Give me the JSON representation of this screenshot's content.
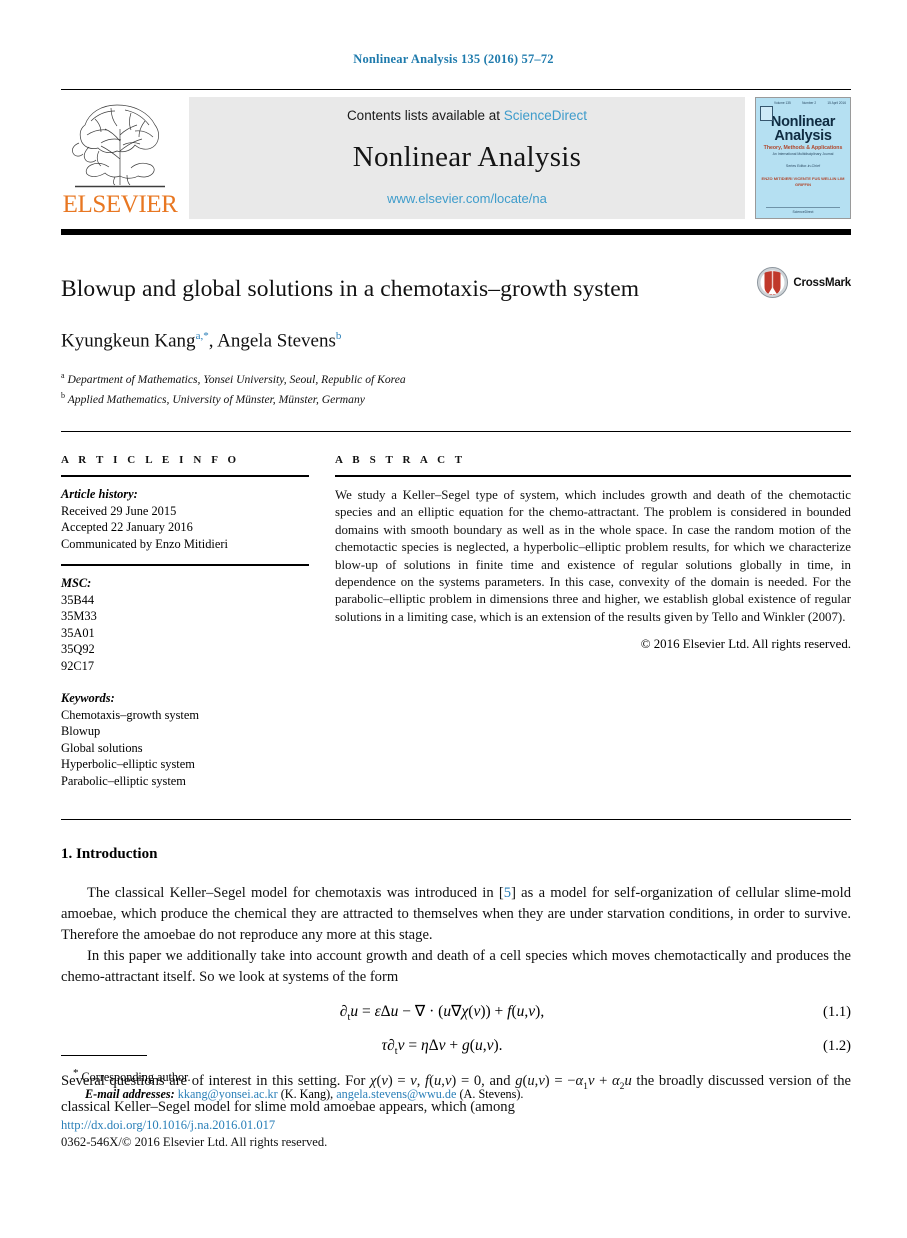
{
  "running_head": "Nonlinear Analysis 135 (2016) 57–72",
  "banner": {
    "publisher": "ELSEVIER",
    "contents_prefix": "Contents lists available at ",
    "contents_link": "ScienceDirect",
    "journal_name": "Nonlinear Analysis",
    "journal_url": "www.elsevier.com/locate/na",
    "cover": {
      "vol": "Volume 135",
      "num": "Number 2",
      "date": "15 April 2016",
      "title_line1": "Nonlinear",
      "title_line2": "Analysis",
      "subtitle": "Theory, Methods & Applications",
      "subtitle2": "An International Multidisciplinary Journal",
      "editors_label": "Series Editor-in-Chief",
      "editors": "ENZO MITIDIERI\nVICENTE FUS\nWEI-LIN LIM GRIFFIN",
      "footer": "ScienceDirect"
    }
  },
  "article": {
    "title": "Blowup and global solutions in a chemotaxis–growth system",
    "crossmark_label": "CrossMark",
    "authors": [
      {
        "name": "Kyungkeun Kang",
        "marks": "a,*"
      },
      {
        "name": "Angela Stevens",
        "marks": "b"
      }
    ],
    "authors_line_sep": ", ",
    "affiliations": [
      {
        "mark": "a",
        "text": "Department of Mathematics, Yonsei University, Seoul, Republic of Korea"
      },
      {
        "mark": "b",
        "text": "Applied Mathematics, University of Münster, Münster, Germany"
      }
    ]
  },
  "article_info": {
    "heading": "A R T I C L E   I N F O",
    "history_label": "Article history:",
    "history": [
      "Received 29 June 2015",
      "Accepted 22 January 2016",
      "Communicated by Enzo Mitidieri"
    ],
    "msc_label": "MSC:",
    "msc": [
      "35B44",
      "35M33",
      "35A01",
      "35Q92",
      "92C17"
    ],
    "keywords_label": "Keywords:",
    "keywords": [
      "Chemotaxis–growth system",
      "Blowup",
      "Global solutions",
      "Hyperbolic–elliptic system",
      "Parabolic–elliptic system"
    ]
  },
  "abstract": {
    "heading": "A B S T R A C T",
    "text": "We study a Keller–Segel type of system, which includes growth and death of the chemotactic species and an elliptic equation for the chemo-attractant. The problem is considered in bounded domains with smooth boundary as well as in the whole space. In case the random motion of the chemotactic species is neglected, a hyperbolic–elliptic problem results, for which we characterize blow-up of solutions in finite time and existence of regular solutions globally in time, in dependence on the systems parameters. In this case, convexity of the domain is needed. For the parabolic–elliptic problem in dimensions three and higher, we establish global existence of regular solutions in a limiting case, which is an extension of the results given by Tello and Winkler (2007).",
    "copyright": "© 2016 Elsevier Ltd. All rights reserved."
  },
  "body": {
    "section_heading": "1. Introduction",
    "para1_a": "The classical Keller–Segel model for chemotaxis was introduced in [",
    "para1_ref": "5",
    "para1_b": "] as a model for self-organization of cellular slime-mold amoebae, which produce the chemical they are attracted to themselves when they are under starvation conditions, in order to survive. Therefore the amoebae do not reproduce any more at this stage.",
    "para2": "In this paper we additionally take into account growth and death of a cell species which moves chemotactically and produces the chemo-attractant itself. So we look at systems of the form",
    "equations": [
      {
        "num": "(1.1)",
        "latex": "∂_t u = ε Δu − ∇ · (u∇χ(v)) + f(u,v),"
      },
      {
        "num": "(1.2)",
        "latex": "τ∂_t v = ηΔv + g(u,v)."
      }
    ],
    "para3": "Several questions are of interest in this setting. For χ(v) = v, f(u,v) = 0, and g(u,v) = −α₁v + α₂u the broadly discussed version of the classical Keller–Segel model for slime mold amoebae appears, which (among"
  },
  "footnotes": {
    "corresponding_mark": "*",
    "corresponding_text": "Corresponding author.",
    "email_label": "E-mail addresses:",
    "emails": [
      {
        "address": "kkang@yonsei.ac.kr",
        "person": "(K. Kang)"
      },
      {
        "address": "angela.stevens@wwu.de",
        "person": "(A. Stevens)"
      }
    ]
  },
  "bottom": {
    "doi": "http://dx.doi.org/10.1016/j.na.2016.01.017",
    "issn_line": "0362-546X/© 2016 Elsevier Ltd. All rights reserved."
  },
  "colors": {
    "link_blue": "#2a7fb8",
    "sciencedirect_blue": "#3e9ccb",
    "elsevier_orange": "#e87722",
    "banner_grey": "#e9e9e9",
    "cover_blue": "#b5e0f2"
  }
}
